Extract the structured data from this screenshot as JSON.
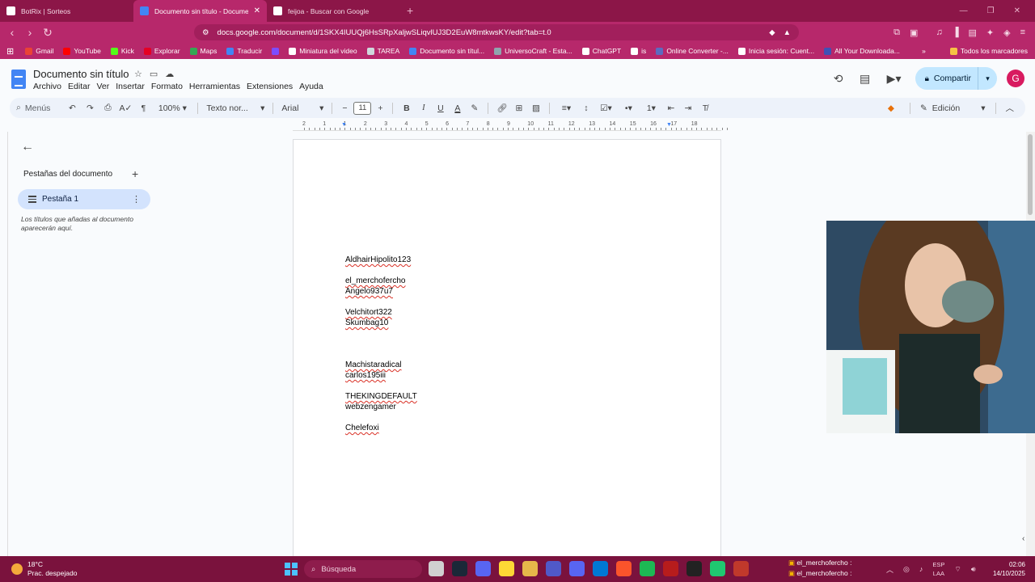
{
  "browser": {
    "tabs": [
      {
        "title": "BotRix | Sorteos",
        "favicon_color": "#ffffff",
        "active": false
      },
      {
        "title": "Documento sin título - Document",
        "favicon_color": "#4285f4",
        "active": true
      },
      {
        "title": "feijoa - Buscar con Google",
        "favicon_color": "#ffffff",
        "active": false
      }
    ],
    "new_tab": "+",
    "url": "docs.google.com/document/d/1SKX4IUUQj6HsSRpXaljwSLiqvlUJ3D2EuW8mtkwsKY/edit?tab=t.0",
    "bookmarks": [
      {
        "label": "Gmail",
        "color": "#ea4335"
      },
      {
        "label": "YouTube",
        "color": "#ff0000"
      },
      {
        "label": "Kick",
        "color": "#53fc18"
      },
      {
        "label": "Explorar",
        "color": "#e60023"
      },
      {
        "label": "Maps",
        "color": "#34a853"
      },
      {
        "label": "Traducir",
        "color": "#4285f4"
      },
      {
        "label": "",
        "color": "#7c4dff"
      },
      {
        "label": "Miniatura del video",
        "color": "#ffffff"
      },
      {
        "label": "TAREA",
        "color": "#cfd8dc"
      },
      {
        "label": "Documento sin títul...",
        "color": "#4285f4"
      },
      {
        "label": "UniversoCraft - Esta...",
        "color": "#90a4ae"
      },
      {
        "label": "ChatGPT",
        "color": "#ffffff"
      },
      {
        "label": "is",
        "color": "#ffffff"
      },
      {
        "label": "Online Converter -...",
        "color": "#5c6bc0"
      },
      {
        "label": "Inicia sesión: Cuent...",
        "color": "#ffffff"
      },
      {
        "label": "All Your Downloada...",
        "color": "#3f51b5"
      }
    ],
    "bookmarks_more": "»",
    "all_bookmarks": "Todos los marcadores"
  },
  "docs": {
    "title": "Documento sin título",
    "menu": [
      "Archivo",
      "Editar",
      "Ver",
      "Insertar",
      "Formato",
      "Herramientas",
      "Extensiones",
      "Ayuda"
    ],
    "share_label": "Compartir",
    "avatar_letter": "G",
    "toolbar": {
      "search": "Menús",
      "zoom": "100%",
      "style": "Texto nor...",
      "font": "Arial",
      "font_size": "11",
      "mode": "Edición"
    },
    "ruler_numbers": [
      "2",
      "1",
      "1",
      "2",
      "3",
      "4",
      "5",
      "6",
      "7",
      "8",
      "9",
      "10",
      "11",
      "12",
      "13",
      "14",
      "15",
      "16",
      "17",
      "18"
    ],
    "sidebar": {
      "title": "Pestañas del documento",
      "tab_label": "Pestaña 1",
      "hint": "Los títulos que añadas al documento aparecerán aquí."
    },
    "lines": [
      {
        "text": "AldhairHipolito123",
        "spell": true
      },
      {
        "text": "",
        "spell": false
      },
      {
        "text": "el_merchofercho",
        "spell": true
      },
      {
        "text": "Angelo937u7",
        "spell": true
      },
      {
        "text": "",
        "spell": false
      },
      {
        "text": "Velchitort322",
        "spell": true
      },
      {
        "text": "Skumbag10",
        "spell": true
      },
      {
        "text": "",
        "spell": false
      },
      {
        "text": "",
        "spell": false
      },
      {
        "text": "",
        "spell": false
      },
      {
        "text": "Machistaradical",
        "spell": true
      },
      {
        "text": "carlos195iii",
        "spell": true
      },
      {
        "text": "",
        "spell": false
      },
      {
        "text": "THEKINGDEFAULT",
        "spell": true
      },
      {
        "text": "webzengamer",
        "spell": false
      },
      {
        "text": "",
        "spell": false
      },
      {
        "text": "Chelefoxi",
        "spell": true
      }
    ]
  },
  "taskbar": {
    "temperature": "18°C",
    "weather": "Prac. despejado",
    "search": "Búsqueda",
    "app_icon_colors": [
      "#d0d0d0",
      "#1b2838",
      "#5865f2",
      "#fdd835",
      "#e6b84a",
      "#5059c9",
      "#5865f2",
      "#0078d4",
      "#fb542b",
      "#1db954",
      "#b71c1c",
      "#222222",
      "#1fc870",
      "#c0392b"
    ],
    "notifications": [
      "el_merchofercho :",
      "el_merchofercho :"
    ],
    "lang_line1": "ESP",
    "lang_line2": "LAA",
    "time": "02:06",
    "date": "14/10/2025"
  }
}
